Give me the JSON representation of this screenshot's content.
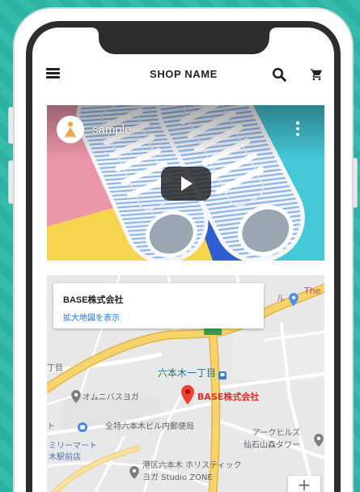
{
  "colors": {
    "background_teal": "#2bb2a2",
    "phone_bezel": "#2d2d2d",
    "link_blue": "#1a73e8",
    "pin_red": "#ea4335",
    "expressway_yellow": "#f6d36b"
  },
  "header": {
    "menu_icon": "hamburger-menu-icon",
    "title": "SHOP NAME",
    "search_icon": "search-icon",
    "cart_icon": "cart-icon"
  },
  "video": {
    "title": "sample",
    "avatar_icon": "channel-avatar-icon",
    "more_icon": "more-vert-icon",
    "play_icon": "play-icon"
  },
  "map": {
    "place_card": {
      "name": "BASE株式会社",
      "enlarge_link": "拡大地図を表示"
    },
    "labels": {
      "the": "The",
      "ru": "ル",
      "chome": "丁目",
      "roppongi_itchome": "六本木一丁目",
      "omnibus_yoga": "オムニバスヨガ",
      "base_marker": "BASE株式会社",
      "to": "ト",
      "post_office": "全特六本木ビル内郵便局",
      "mart_line1": "ミリーマート",
      "mart_line2": "木駅前店",
      "ark_hills_line1": "アークヒルズ",
      "ark_hills_line2": "仙石山森タワー",
      "holistic_line1": "港区六本木 ホリスティック",
      "holistic_line2": "ヨガ Studio ZONE"
    },
    "zoom_in_label": "+"
  }
}
